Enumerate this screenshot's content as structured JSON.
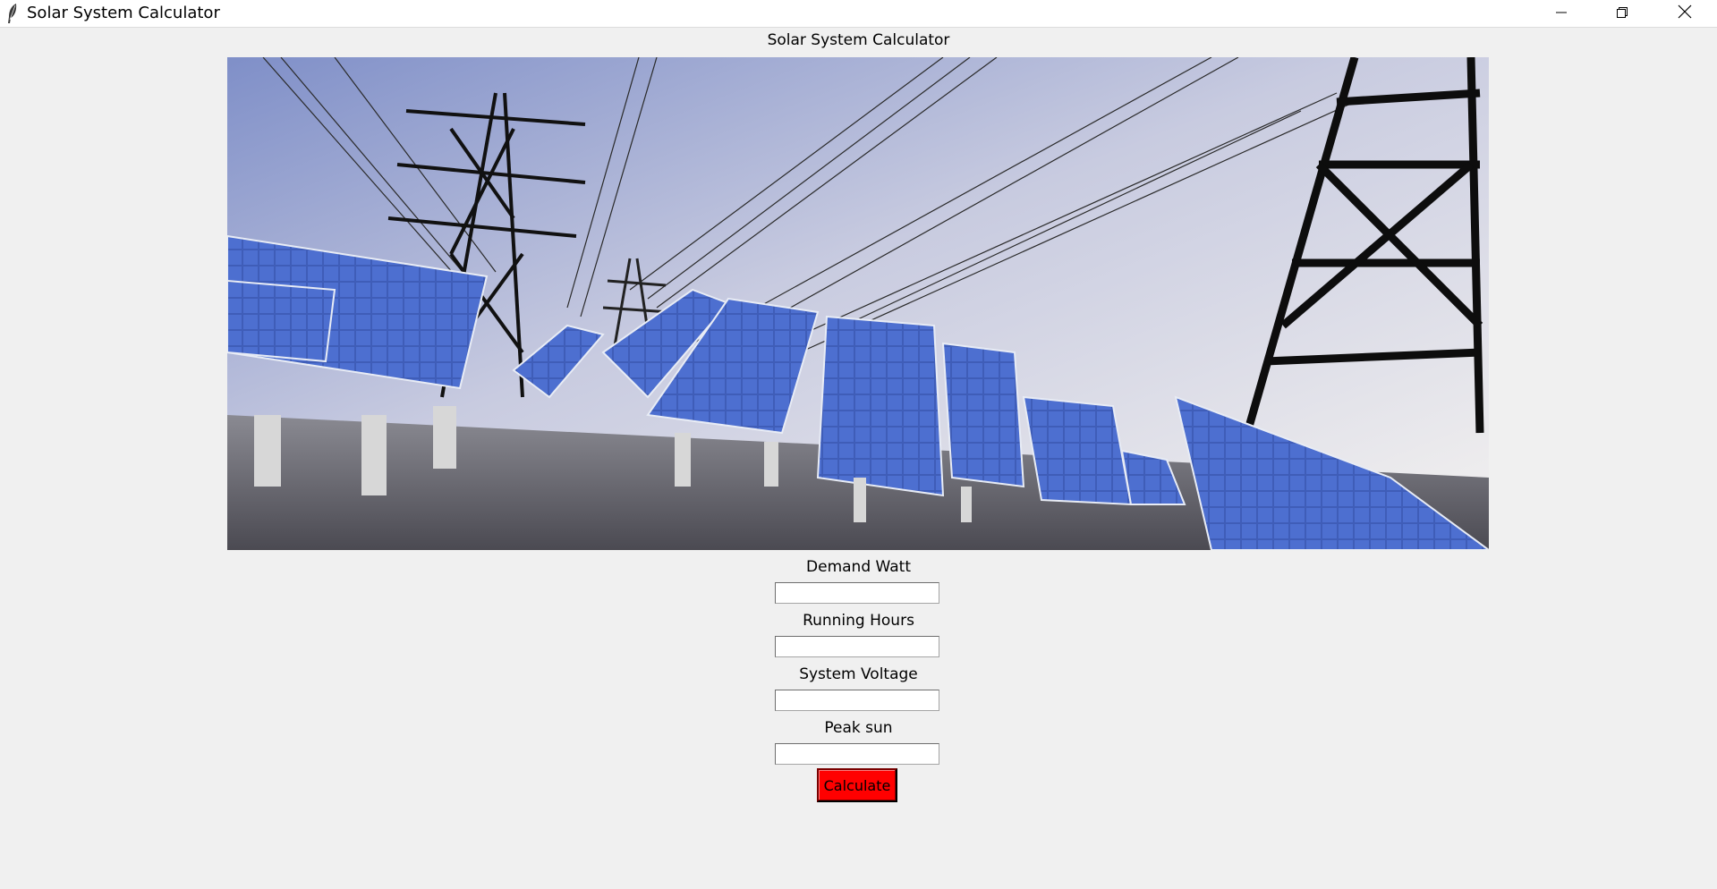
{
  "window": {
    "title": "Solar System Calculator",
    "icon": "feather-icon"
  },
  "heading": "Solar System Calculator",
  "banner": {
    "image": "solar-panels-and-power-pylons-photo"
  },
  "fields": [
    {
      "label": "Demand Watt",
      "value": ""
    },
    {
      "label": "Running Hours",
      "value": ""
    },
    {
      "label": "System Voltage",
      "value": ""
    },
    {
      "label": "Peak sun",
      "value": ""
    }
  ],
  "calculate_button": {
    "label": "Calculate",
    "color": "#ff0000"
  }
}
